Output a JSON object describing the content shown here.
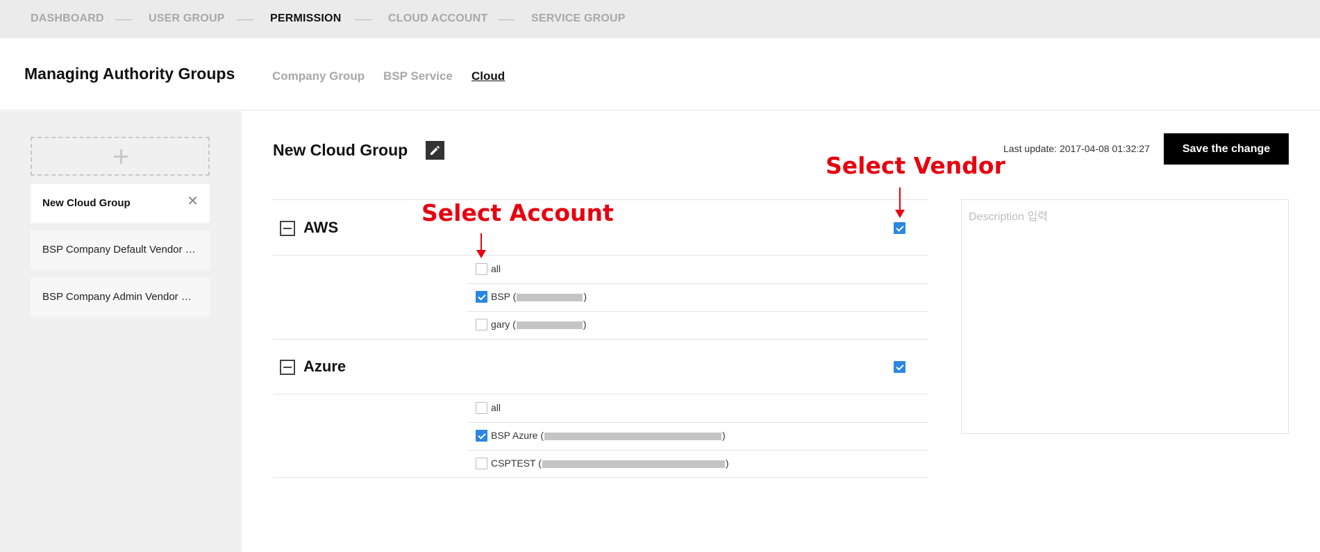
{
  "topnav": {
    "steps": [
      {
        "label": "DASHBOARD",
        "active": false
      },
      {
        "label": "USER GROUP",
        "active": false
      },
      {
        "label": "PERMISSION",
        "active": true
      },
      {
        "label": "CLOUD ACCOUNT",
        "active": false
      },
      {
        "label": "SERVICE GROUP",
        "active": false
      }
    ]
  },
  "header": {
    "title": "Managing Authority Groups",
    "tabs": [
      {
        "label": "Company Group",
        "active": false
      },
      {
        "label": "BSP Service",
        "active": false
      },
      {
        "label": "Cloud",
        "active": true
      }
    ]
  },
  "sidebar": {
    "add_icon": "plus-icon",
    "groups": [
      {
        "label": "New Cloud Group",
        "active": true,
        "close_icon": "close-icon",
        "close_glyph": "✕"
      },
      {
        "label": "BSP Company Default Vendor Group",
        "active": false
      },
      {
        "label": "BSP Company Admin Vendor Group",
        "active": false
      }
    ]
  },
  "main": {
    "title": "New Cloud Group",
    "edit_icon": "pencil-icon",
    "last_update": "Last update: 2017-04-08 01:32:27",
    "save_label": "Save the change",
    "description_placeholder": "Description 입력",
    "description_value": "",
    "check_color": "#2b87e3",
    "vendors": [
      {
        "name": "AWS",
        "selected": true,
        "accounts": [
          {
            "label": "all",
            "checked": false
          },
          {
            "label": "BSP (",
            "suffix": ")",
            "checked": true
          },
          {
            "label": "gary (",
            "suffix": ")",
            "checked": false
          }
        ]
      },
      {
        "name": "Azure",
        "selected": true,
        "accounts": [
          {
            "label": "all",
            "checked": false
          },
          {
            "label": "BSP Azure (",
            "suffix": ")",
            "checked": true
          },
          {
            "label": "CSPTEST (",
            "suffix": ")",
            "checked": false
          }
        ]
      }
    ]
  },
  "annotations": {
    "select_vendor": "Select Vendor",
    "select_account": "Select Account",
    "color": "#e8000f"
  }
}
